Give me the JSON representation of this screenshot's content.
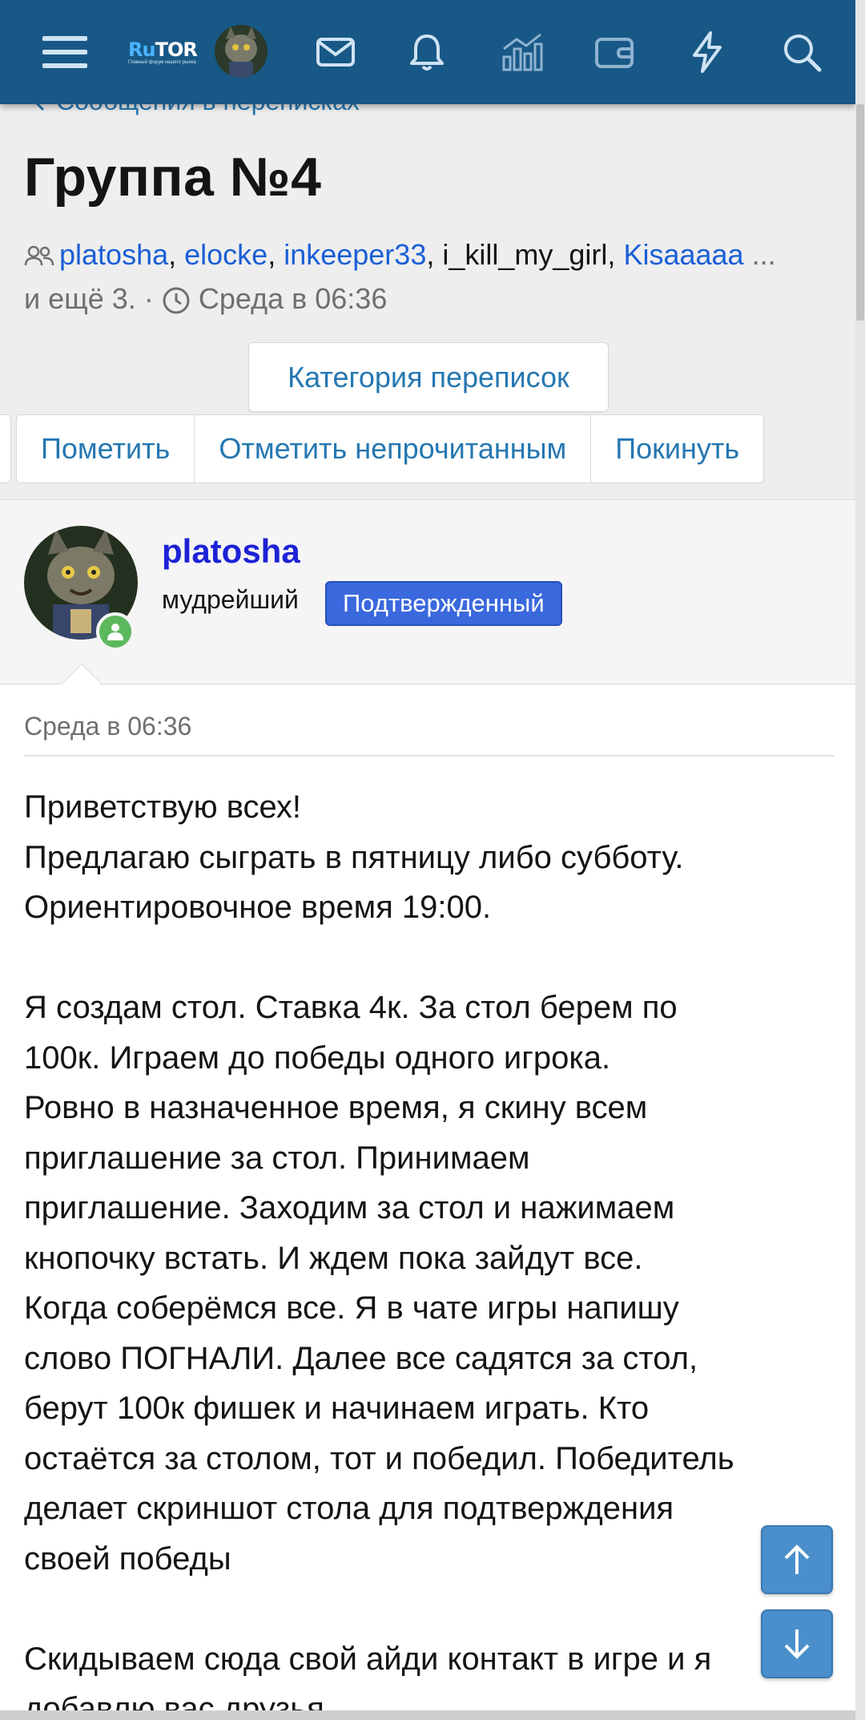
{
  "navbar": {
    "logo_main_ru": "Ru",
    "logo_main_tor": "TOR",
    "logo_sub": "Главный форум нашего рынка",
    "icons": [
      "menu-icon",
      "avatar",
      "mail-icon",
      "bell-icon",
      "chart-icon",
      "wallet-icon",
      "lightning-icon",
      "search-icon"
    ]
  },
  "breadcrumb": {
    "label": "Сообщения в переписках"
  },
  "conversation": {
    "title": "Группа №4",
    "participants": [
      "platosha",
      "elocke",
      "inkeeper33",
      "i_kill_my_girl",
      "Kisaaaaa"
    ],
    "more": "и ещё 3.",
    "separator": "·",
    "date": "Среда в 06:36"
  },
  "buttons": {
    "category": "Категория переписок",
    "mark": "Пометить",
    "mark_unread": "Отметить непрочитанным",
    "leave": "Покинуть"
  },
  "post": {
    "username": "platosha",
    "user_title": "мудрейший",
    "badge": "Подтвержденный",
    "date": "Среда в 06:36",
    "text": "Приветствую всех!\nПредлагаю сыграть в пятницу либо субботу.\nОриентировочное время 19:00.\n\nЯ создам стол. Ставка 4к. За стол берем по\n100к. Играем до победы одного игрока.\nРовно в назначенное время, я скину всем\nприглашение за стол. Принимаем\nприглашение. Заходим за стол и нажимаем\nкнопочку встать. И ждем пока зайдут все.\nКогда соберёмся все. Я в чате игры напишу\nслово ПОГНАЛИ. Далее все садятся за стол,\nберут 100к фишек и начинаем играть. Кто\nостаётся за столом, тот и победил. Победитель\nделает скриншот стола для подтверждения\nсвоей победы\n\nСкидываем сюда свой айди контакт в игре и я\nдобавлю вас друзья."
  },
  "colors": {
    "navbar": "#185886",
    "link": "#2577b1",
    "username": "#1d22d6",
    "badge": "#3a68dd",
    "online": "#5cb85c"
  }
}
